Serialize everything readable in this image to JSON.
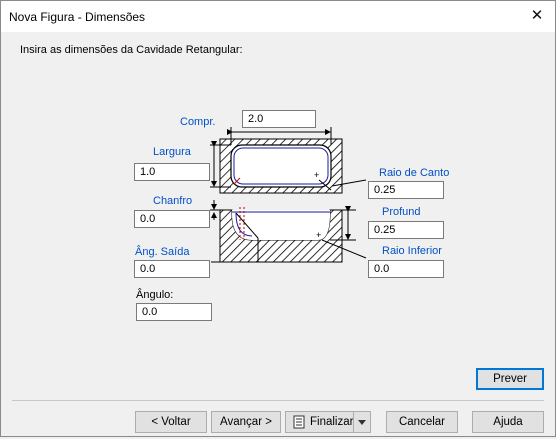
{
  "window": {
    "title": "Nova Figura - Dimensões",
    "close_glyph": "✕"
  },
  "instruction": "Insira as dimensões da Cavidade Retangular:",
  "labels": {
    "compr": "Compr.",
    "largura": "Largura",
    "raio_canto": "Raio de Canto",
    "chanfro": "Chanfro",
    "profund": "Profund",
    "ang_saida": "Âng. Saída",
    "raio_inferior": "Raio Inferior",
    "angulo": "Ângulo:"
  },
  "fields": {
    "compr": "2.0",
    "largura": "1.0",
    "raio_canto": "0.25",
    "chanfro": "0.0",
    "profund": "0.25",
    "ang_saida": "0.0",
    "raio_inferior": "0.0",
    "angulo": "0.0"
  },
  "buttons": {
    "prever": "Prever",
    "voltar": "< Voltar",
    "avancar": "Avançar >",
    "finalizar": "Finalizar",
    "cancelar": "Cancelar",
    "ajuda": "Ajuda"
  },
  "colors": {
    "accent": "#0050c8",
    "focus": "#0078d7",
    "diagram_line": "#1a1aa6"
  }
}
